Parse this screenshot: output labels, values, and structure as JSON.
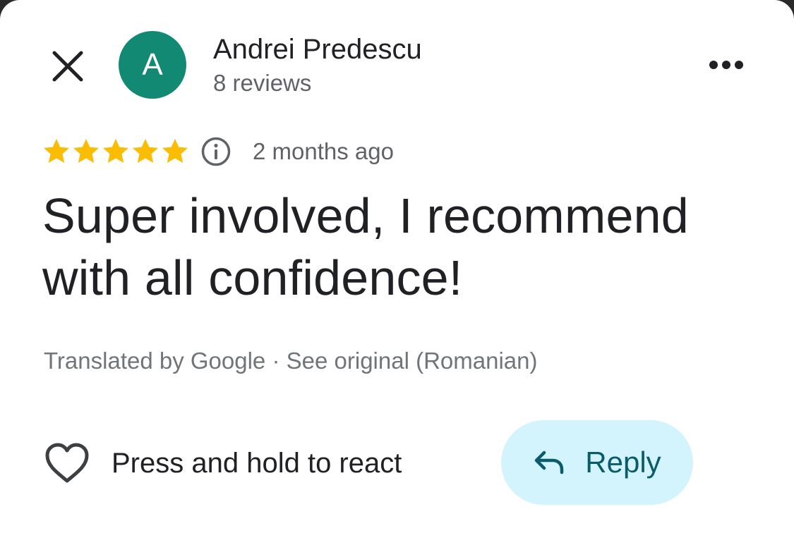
{
  "author": {
    "initial": "A",
    "name": "Andrei Predescu",
    "reviews": "8 reviews"
  },
  "review": {
    "rating": 5,
    "max_rating": 5,
    "time": "2 months ago",
    "text": "Super involved, I recommend with all confidence!",
    "translated_by": "Translated by Google",
    "separator": "·",
    "see_original": "See original (Romanian)"
  },
  "actions": {
    "react_label": "Press and hold to react",
    "reply_label": "Reply"
  },
  "icons": {
    "close": "close-icon",
    "more": "more-horizontal-icon",
    "star": "star-icon",
    "info": "info-icon",
    "heart": "heart-outline-icon",
    "reply": "reply-arrow-icon"
  },
  "colors": {
    "avatar_bg": "#128a73",
    "star": "#fbbc04",
    "reply_bg": "#d3f4fc",
    "reply_text": "#0a5c6b",
    "primary_text": "#202124",
    "secondary_text": "#5f6368"
  }
}
